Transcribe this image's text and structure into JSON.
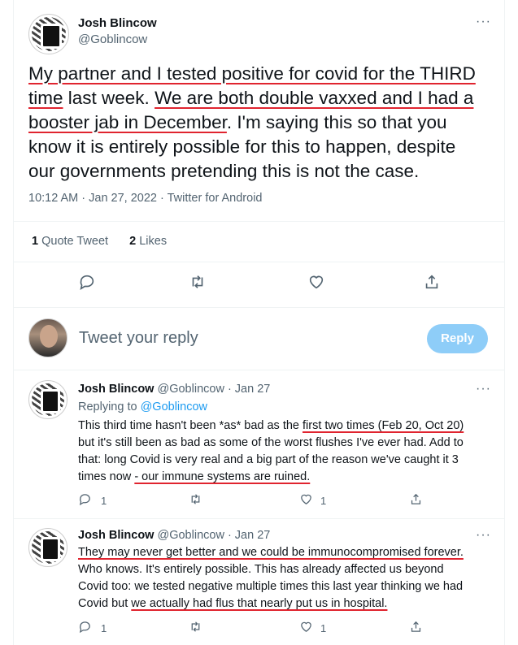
{
  "tweet": {
    "author_name": "Josh Blincow",
    "author_handle": "@Goblincow",
    "more_label": "···",
    "text_lines": [
      [
        {
          "t": "My partner and I tested positive for covid for the THIRD",
          "u": true
        }
      ],
      [
        {
          "t": "time",
          "u": true
        },
        {
          "t": " last week. ",
          "u": false
        },
        {
          "t": "We are both double vaxxed and I had a",
          "u": true
        }
      ],
      [
        {
          "t": "booster jab in December",
          "u": true
        },
        {
          "t": ". I'm saying this so that you",
          "u": false
        }
      ],
      [
        {
          "t": "know it is entirely possible for this to happen, despite",
          "u": false
        }
      ],
      [
        {
          "t": "our governments pretending this is not the case.",
          "u": false
        }
      ]
    ],
    "meta": "10:12 AM · Jan 27, 2022 · Twitter for Android",
    "stats": {
      "quote_count": "1",
      "quote_label": " Quote Tweet",
      "like_count": "2",
      "like_label": " Likes"
    },
    "actions": [
      "reply-icon",
      "retweet-icon",
      "like-icon",
      "share-icon"
    ]
  },
  "composer": {
    "placeholder": "Tweet your reply",
    "button_label": "Reply",
    "button_color": "#8ecdf8"
  },
  "replies": [
    {
      "author_name": "Josh Blincow",
      "author_handle": "@Goblincow · Jan 27",
      "replying_prefix": "Replying to ",
      "replying_to": "@Goblincow",
      "text_lines": [
        [
          {
            "t": "This third time hasn't been *as* bad as the ",
            "u": false
          },
          {
            "t": "first two times (Feb 20, Oct 20)",
            "u": true
          }
        ],
        [
          {
            "t": "but it's still been as bad as some of the worst flushes I've ever had. Add to",
            "u": false
          }
        ],
        [
          {
            "t": "that: long Covid is very real and a big part of the reason we've caught it 3",
            "u": false
          }
        ],
        [
          {
            "t": "times now ",
            "u": false
          },
          {
            "t": "- our immune systems are ruined.",
            "u": true
          }
        ]
      ],
      "reply_count": "1",
      "retweet_count": "",
      "like_count": "1"
    },
    {
      "author_name": "Josh Blincow",
      "author_handle": "@Goblincow · Jan 27",
      "text_lines": [
        [
          {
            "t": "They may never get better and we could be immunocompromised forever.",
            "u": true
          }
        ],
        [
          {
            "t": "Who knows. It's entirely possible. This has already affected us beyond",
            "u": false
          }
        ],
        [
          {
            "t": "Covid too: we tested negative multiple times this last year thinking we had",
            "u": false
          }
        ],
        [
          {
            "t": "Covid but ",
            "u": false
          },
          {
            "t": "we actually had flus that nearly put us in hospital.",
            "u": true
          }
        ]
      ],
      "reply_count": "1",
      "retweet_count": "",
      "like_count": "1"
    }
  ],
  "colors": {
    "underline": "#e0242f",
    "link": "#1d9bf0",
    "secondary_text": "#536471"
  }
}
